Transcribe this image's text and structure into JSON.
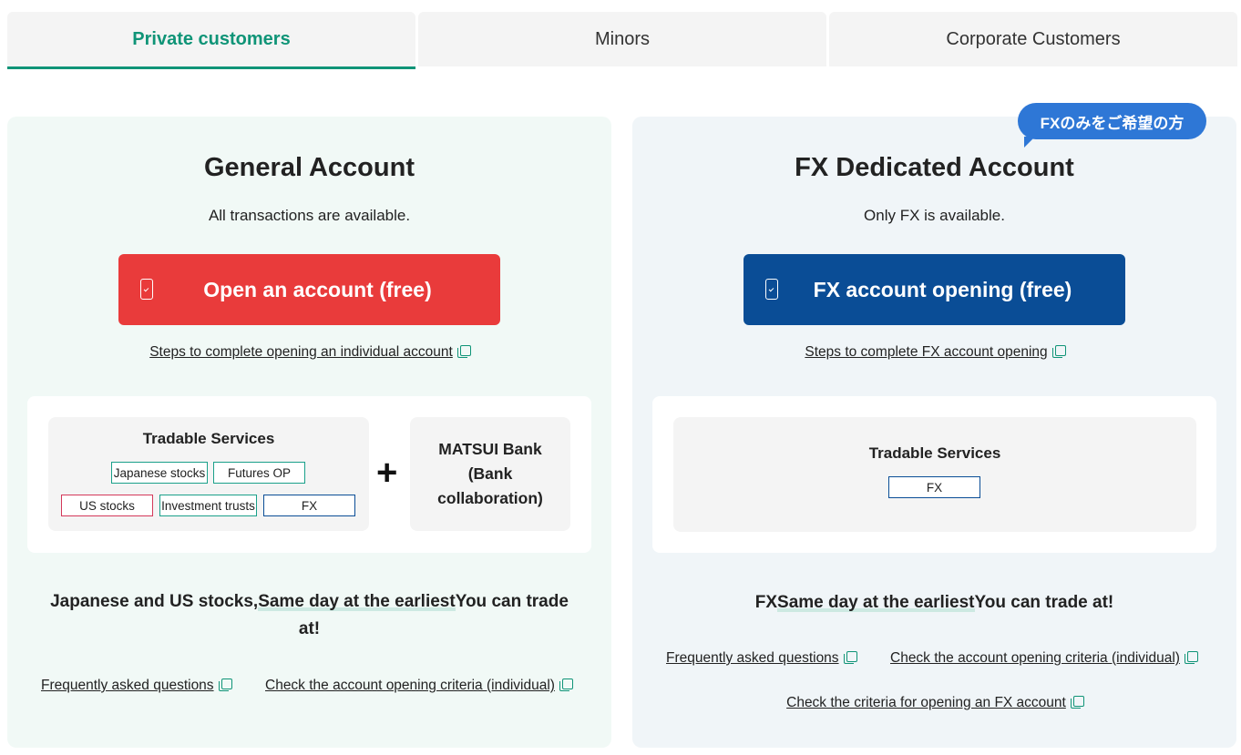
{
  "tabs": [
    {
      "label": "Private customers",
      "active": true
    },
    {
      "label": "Minors",
      "active": false
    },
    {
      "label": "Corporate Customers",
      "active": false
    }
  ],
  "general": {
    "title": "General Account",
    "subtitle": "All transactions are available.",
    "cta_label": "Open an account (free)",
    "steps_link": "Steps to complete opening an individual account",
    "services_title": "Tradable Services",
    "services": [
      "Japanese stocks",
      "Futures OP",
      "US stocks",
      "Investment trusts",
      "FX"
    ],
    "plus": "+",
    "bank_label": "MATSUI Bank (Bank collaboration)",
    "headline_pre": "Japanese and US stocks,",
    "headline_hl": "Same day at the earliest",
    "headline_post": "You can trade",
    "headline_end": "at!",
    "faq_link": "Frequently asked questions",
    "criteria_link": "Check the account opening criteria (individual)"
  },
  "fx": {
    "badge": "FXのみをご希望の方",
    "title": "FX Dedicated Account",
    "subtitle": "Only FX is available.",
    "cta_label": "FX account opening (free)",
    "steps_link": "Steps to complete FX account opening",
    "services_title": "Tradable Services",
    "services": [
      "FX"
    ],
    "headline_pre": "FX",
    "headline_hl": "Same day at the earliest",
    "headline_post": "You can trade at!",
    "faq_link": "Frequently asked questions",
    "criteria_link": "Check the account opening criteria (individual)",
    "fx_criteria_link": "Check the criteria for opening an FX account"
  },
  "colors": {
    "accent_green": "#0f9477",
    "cta_red": "#e93b3b",
    "cta_blue": "#0a4d96",
    "badge_blue": "#2e77d6"
  }
}
